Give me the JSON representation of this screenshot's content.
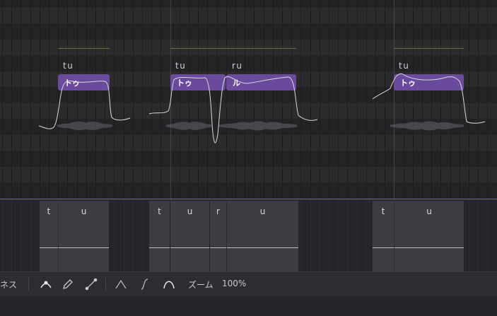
{
  "notes": [
    {
      "phoneme": "tu",
      "lyric": "トゥ"
    },
    {
      "phoneme": "tu",
      "lyric": "トゥ"
    },
    {
      "phoneme": "ru",
      "lyric": "ル"
    },
    {
      "phoneme": "tu",
      "lyric": "トゥ"
    }
  ],
  "phoneme_groups": [
    {
      "segments": [
        "t",
        "u"
      ]
    },
    {
      "segments": [
        "t",
        "u",
        "r",
        "u"
      ]
    },
    {
      "segments": [
        "t",
        "u"
      ]
    }
  ],
  "toolbar": {
    "param_label": "ネス",
    "zoom_label": "ズーム",
    "zoom_value": "100%",
    "icons": [
      "curve-point-tool-icon",
      "pencil-icon",
      "line-tool-icon",
      "peak-curve-icon",
      "s-curve-icon",
      "arc-curve-icon"
    ]
  },
  "colors": {
    "note": "#6a4a9c",
    "playhead_divider": "#7b5bc8",
    "guide_line": "#5f7a3a",
    "segment": "#3c3c41"
  }
}
